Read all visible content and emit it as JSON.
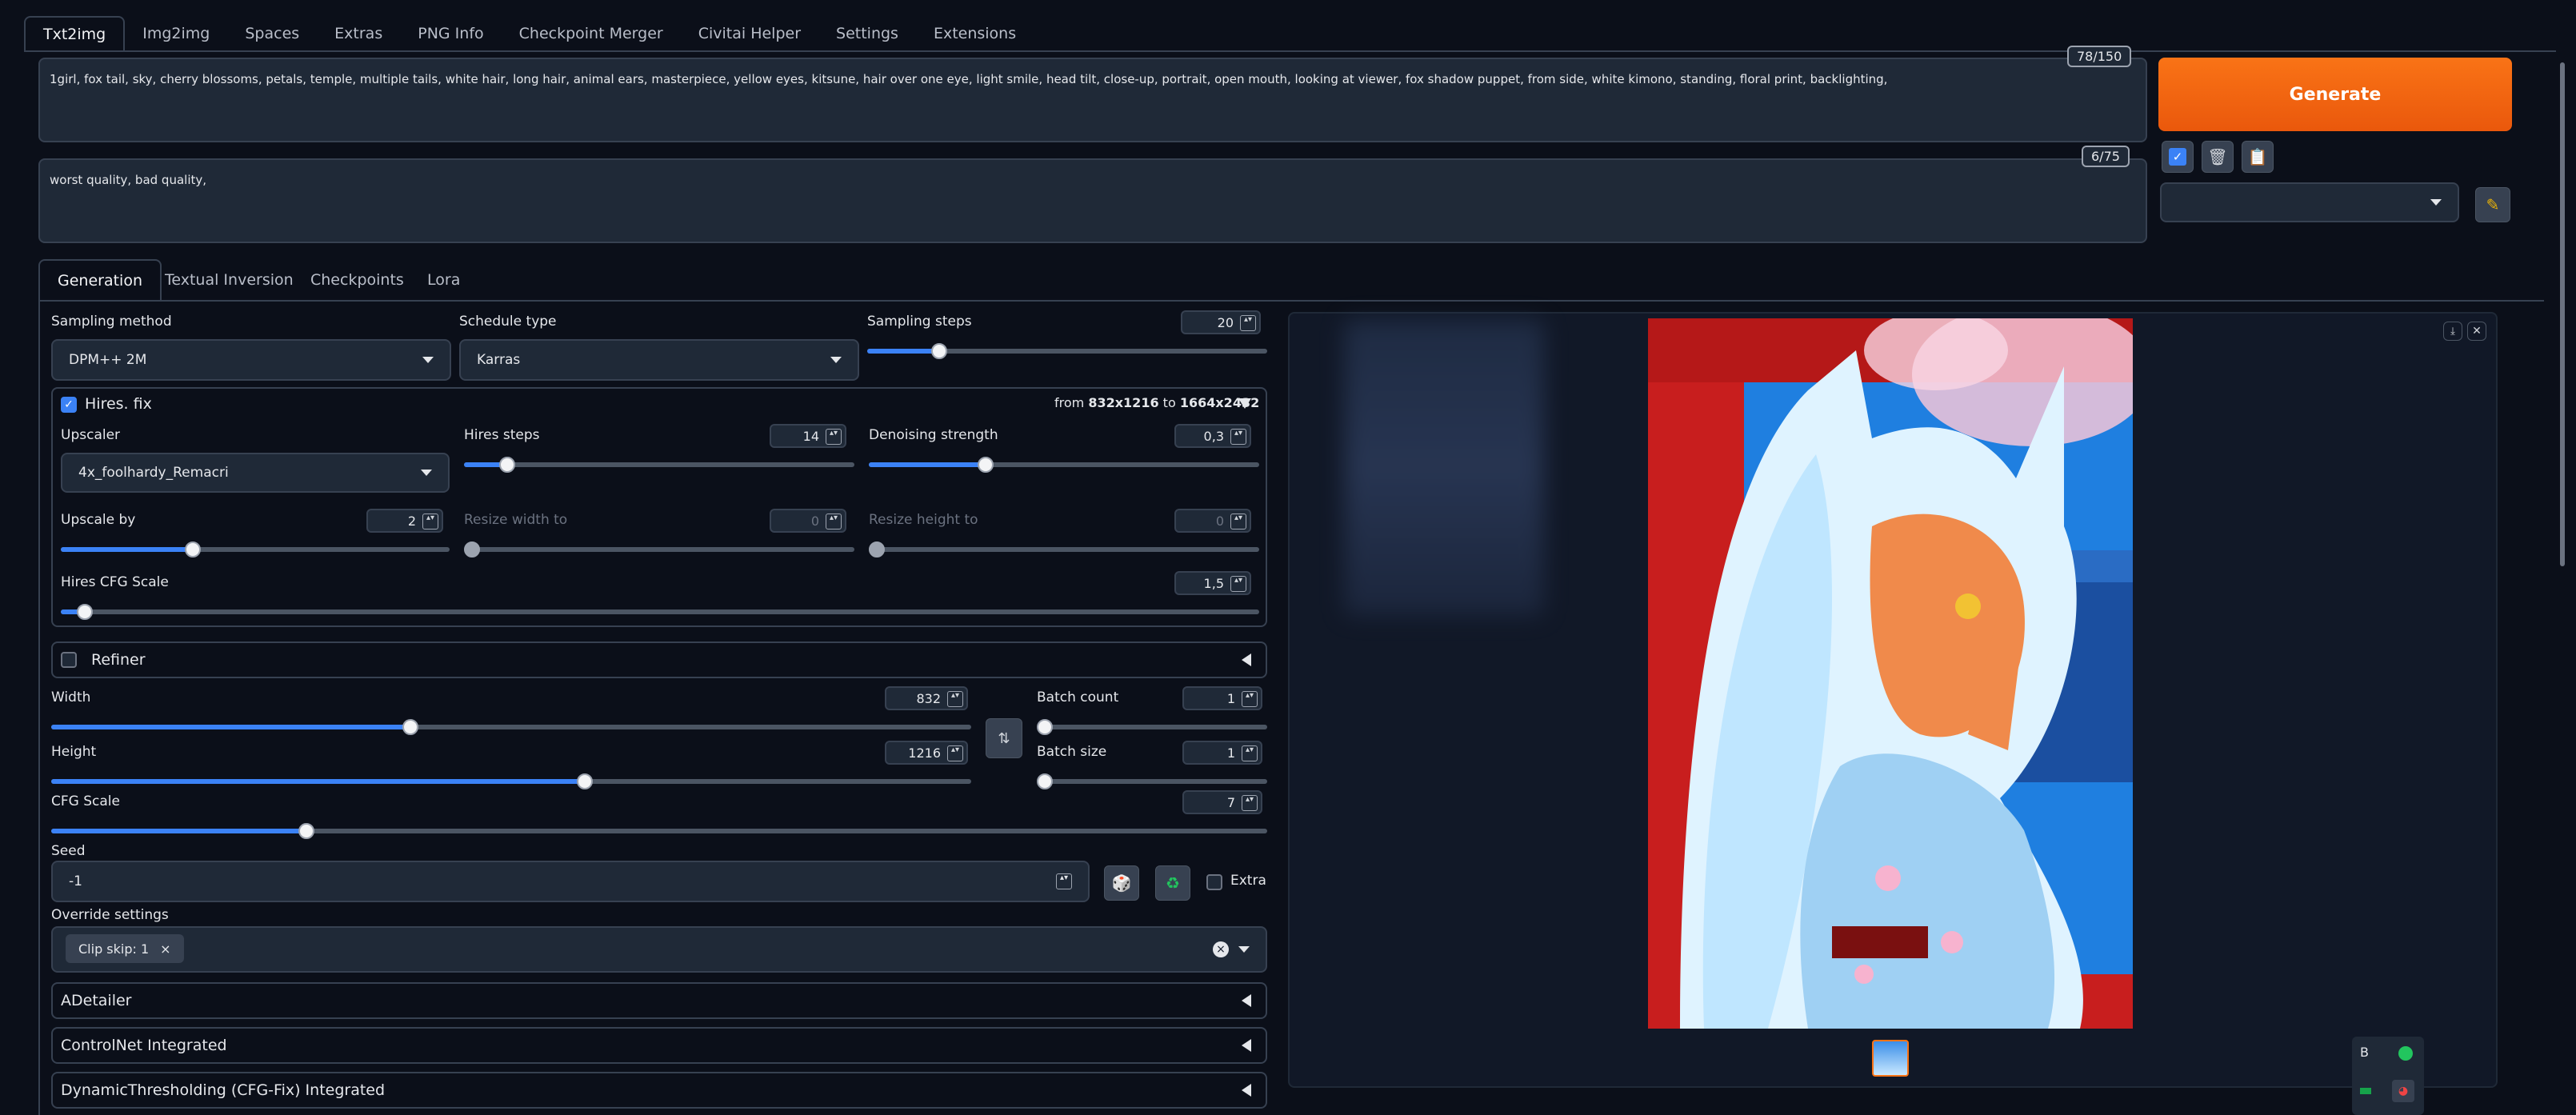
{
  "tabs": [
    "Txt2img",
    "Img2img",
    "Spaces",
    "Extras",
    "PNG Info",
    "Checkpoint Merger",
    "Civitai Helper",
    "Settings",
    "Extensions"
  ],
  "prompt": {
    "positive": "1girl, fox tail, sky, cherry blossoms, petals, temple, multiple tails, white hair, long hair, animal ears, masterpiece, yellow eyes, kitsune, hair over one eye, light smile, head tilt, close-up, portrait, open mouth, looking at viewer, fox shadow puppet, from side, white kimono, standing, floral print, backlighting,",
    "positive_count": "78/150",
    "negative": "worst quality, bad quality,",
    "negative_count": "6/75"
  },
  "actions": {
    "generate_label": "Generate",
    "icons": [
      "checkbox-icon",
      "trash-icon",
      "clipboard-icon",
      "pencil-icon"
    ],
    "style_select_value": ""
  },
  "subtabs": [
    "Generation",
    "Textual Inversion",
    "Checkpoints",
    "Lora"
  ],
  "generation": {
    "sampling_method_label": "Sampling method",
    "sampling_method": "DPM++ 2M",
    "schedule_type_label": "Schedule type",
    "schedule_type": "Karras",
    "sampling_steps_label": "Sampling steps",
    "sampling_steps": "20",
    "hires": {
      "title": "Hires. fix",
      "enabled": true,
      "from_text": "from",
      "from_value": "832x1216",
      "to_text": "to",
      "to_value": "1664x2432",
      "upscaler_label": "Upscaler",
      "upscaler": "4x_foolhardy_Remacri",
      "hires_steps_label": "Hires steps",
      "hires_steps": "14",
      "denoising_label": "Denoising strength",
      "denoising": "0,3",
      "upscale_by_label": "Upscale by",
      "upscale_by": "2",
      "resize_width_label": "Resize width to",
      "resize_width": "0",
      "resize_height_label": "Resize height to",
      "resize_height": "0",
      "cfg_label": "Hires CFG Scale",
      "cfg": "1,5"
    },
    "refiner_label": "Refiner",
    "width_label": "Width",
    "width": "832",
    "height_label": "Height",
    "height": "1216",
    "batch_count_label": "Batch count",
    "batch_count": "1",
    "batch_size_label": "Batch size",
    "batch_size": "1",
    "cfg_label": "CFG Scale",
    "cfg": "7",
    "seed_label": "Seed",
    "seed": "-1",
    "extra_label": "Extra",
    "override_label": "Override settings",
    "override_tag": "Clip skip: 1",
    "accordions": [
      "ADetailer",
      "ControlNet Integrated",
      "DynamicThresholding (CFG-Fix) Integrated"
    ]
  },
  "sliders": {
    "sampling_steps": 0.18,
    "hires_steps": 0.11,
    "denoising": 0.3,
    "upscale_by": 0.34,
    "resize_width": 0,
    "resize_height": 0,
    "hires_cfg": 0.02,
    "width": 0.39,
    "height": 0.58,
    "batch_count": 0,
    "batch_size": 0,
    "cfg": 0.21
  },
  "colors": {
    "accent": "#3b82f6",
    "generate": "#f97316",
    "background": "#0b0f19"
  }
}
